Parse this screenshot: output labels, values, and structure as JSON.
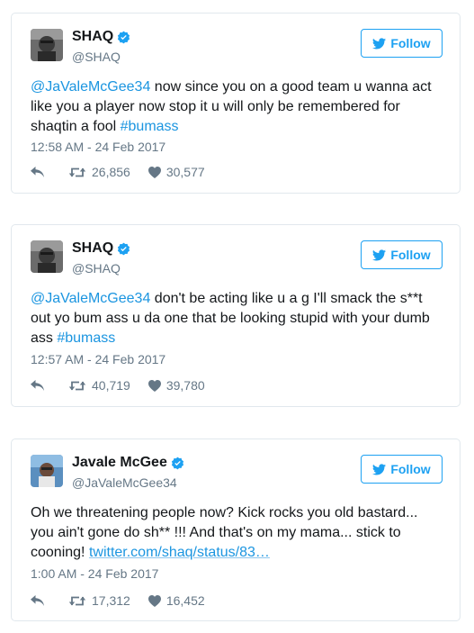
{
  "colors": {
    "accent": "#1da1f2",
    "link": "#1b95e0",
    "muted": "#657786",
    "border": "#e1e8ed"
  },
  "follow_label": "Follow",
  "tweets": [
    {
      "name": "SHAQ",
      "handle": "@SHAQ",
      "verified": true,
      "avatar": "shaq-avatar",
      "text_parts": [
        {
          "type": "mention",
          "text": "@JaValeMcGee34"
        },
        {
          "type": "text",
          "text": " now since you on a good team u wanna act like you a player now stop it u will only be remembered for shaqtin a fool "
        },
        {
          "type": "hashtag",
          "text": "#bumass"
        }
      ],
      "timestamp": "12:58 AM - 24 Feb 2017",
      "retweets": "26,856",
      "likes": "30,577"
    },
    {
      "name": "SHAQ",
      "handle": "@SHAQ",
      "verified": true,
      "avatar": "shaq-avatar",
      "text_parts": [
        {
          "type": "mention",
          "text": "@JaValeMcGee34"
        },
        {
          "type": "text",
          "text": " don't be acting like u a g I'll smack the s**t out yo bum ass u da one that be looking stupid with your dumb ass "
        },
        {
          "type": "hashtag",
          "text": "#bumass"
        }
      ],
      "timestamp": "12:57 AM - 24 Feb 2017",
      "retweets": "40,719",
      "likes": "39,780"
    },
    {
      "name": "Javale McGee",
      "handle": "@JaValeMcGee34",
      "verified": true,
      "avatar": "javale-avatar",
      "text_parts": [
        {
          "type": "text",
          "text": "Oh we threatening people now? Kick rocks you old bastard... you ain't gone do sh** !!! And that's on my mama... stick to cooning! "
        },
        {
          "type": "url",
          "text": "twitter.com/shaq/status/83…"
        }
      ],
      "timestamp": "1:00 AM - 24 Feb 2017",
      "retweets": "17,312",
      "likes": "16,452"
    }
  ]
}
